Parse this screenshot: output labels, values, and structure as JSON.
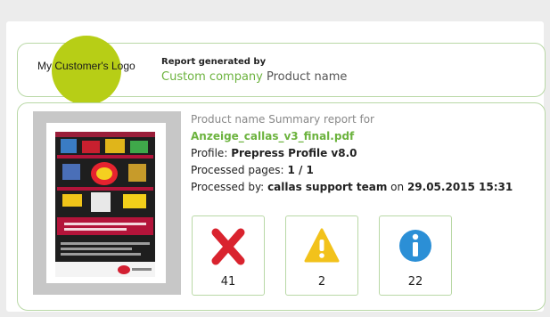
{
  "header": {
    "logo_text": "My Customer's Logo",
    "report_generated_label": "Report generated by",
    "company_name": "Custom company",
    "product_name": "Product name"
  },
  "summary": {
    "title": "Product name Summary report for",
    "filename": "Anzeige_callas_v3_final.pdf",
    "profile_label": "Profile:",
    "profile_value": "Prepress Profile v8.0",
    "pages_label": "Processed pages:",
    "pages_value": "1 / 1",
    "by_label": "Processed by:",
    "by_value": "callas support team",
    "on_label": "on",
    "date_value": "29.05.2015 15:31"
  },
  "counts": {
    "errors": "41",
    "warnings": "2",
    "info": "22"
  },
  "colors": {
    "accent_green": "#6cb33e",
    "logo_circle": "#b7ce16",
    "error_red": "#d9232e",
    "warning_yellow": "#f2c21b",
    "info_blue": "#2b8fd6"
  }
}
